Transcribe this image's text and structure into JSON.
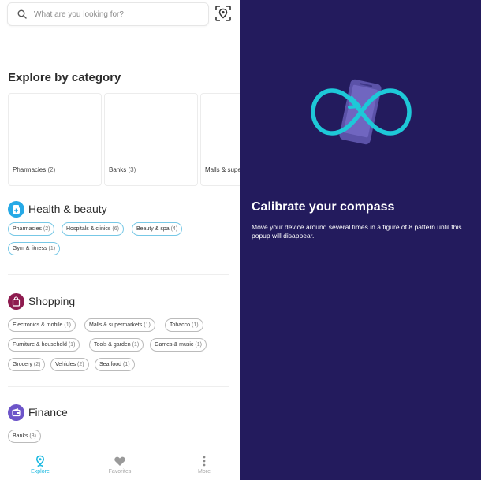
{
  "search": {
    "placeholder": "What are you looking for?"
  },
  "explore": {
    "title": "Explore by category",
    "cards": [
      {
        "label": "Pharmacies",
        "count": "(2)"
      },
      {
        "label": "Banks",
        "count": "(3)"
      },
      {
        "label": "Malls & supe",
        "count": ""
      }
    ]
  },
  "groups": {
    "health": {
      "title": "Health & beauty",
      "color": "#26a9e6",
      "chips": [
        {
          "label": "Pharmacies",
          "count": "(2)"
        },
        {
          "label": "Hospitals & clinics",
          "count": "(6)"
        },
        {
          "label": "Beauty & spa",
          "count": "(4)"
        },
        {
          "label": "Gym & fitness",
          "count": "(1)"
        }
      ]
    },
    "shopping": {
      "title": "Shopping",
      "color": "#8e1b4f",
      "chips": [
        {
          "label": "Electronics & mobile",
          "count": "(1)"
        },
        {
          "label": "Malls & supermarkets",
          "count": "(1)"
        },
        {
          "label": "Tobacco",
          "count": "(1)"
        },
        {
          "label": "Furniture & household",
          "count": "(1)"
        },
        {
          "label": "Tools & garden",
          "count": "(1)"
        },
        {
          "label": "Games & music",
          "count": "(1)"
        },
        {
          "label": "Grocery",
          "count": "(2)"
        },
        {
          "label": "Vehicles",
          "count": "(2)"
        },
        {
          "label": "Sea food",
          "count": "(1)"
        }
      ]
    },
    "finance": {
      "title": "Finance",
      "color": "#6d55c9",
      "chips": [
        {
          "label": "Banks",
          "count": "(3)"
        }
      ]
    }
  },
  "nav": {
    "explore": "Explore",
    "favorites": "Favorites",
    "more": "More",
    "active_color": "#18b8e0"
  },
  "calibrate": {
    "title": "Calibrate your compass",
    "body": "Move your device around several times in a figure of 8 pattern until this popup will disappear.",
    "bg_color": "#231b5d",
    "accent": "#1ec8d8"
  }
}
